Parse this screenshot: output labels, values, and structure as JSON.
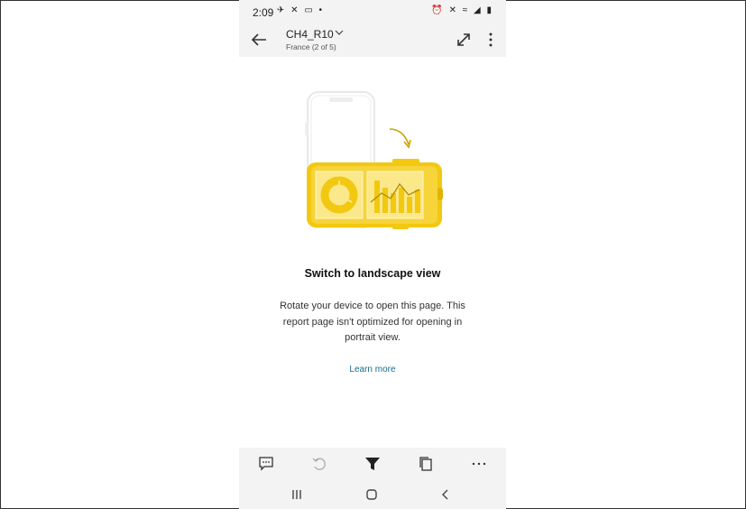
{
  "status_bar": {
    "time": "2:09",
    "left_icons": "✈ ✕ ▭ •",
    "right_icons": "⏰ ✕ ≈ ◢ ▮"
  },
  "app_bar": {
    "title": "CH4_R10",
    "subtitle": "France (2 of 5)",
    "icons": [
      "back-arrow-icon",
      "chevron-down-icon",
      "expand-icon",
      "more-vertical-icon"
    ]
  },
  "message": {
    "heading": "Switch to landscape view",
    "body": "Rotate your device to open this page. This report page isn't optimized for opening in portrait view.",
    "link": "Learn more"
  },
  "illustration": {
    "accent": "#f2c811",
    "light_accent": "#fbe88a",
    "dark_accent": "#c9a100"
  },
  "bottom_toolbar": {
    "icons": [
      "comment-icon",
      "undo-icon",
      "filter-icon",
      "pages-icon",
      "more-horizontal-icon"
    ]
  },
  "nav_bar": {
    "icons": [
      "recent-apps-icon",
      "home-icon",
      "back-icon"
    ]
  }
}
